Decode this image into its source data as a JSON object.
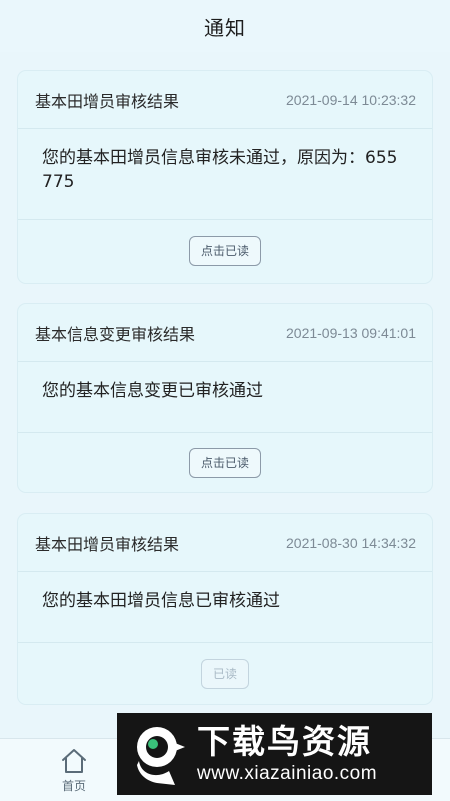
{
  "header": {
    "title": "通知"
  },
  "notifications": [
    {
      "title": "基本田增员审核结果",
      "time": "2021-09-14 10:23:32",
      "content": "您的基本田增员信息审核未通过，原因为：655775",
      "button": "点击已读",
      "read": false
    },
    {
      "title": "基本信息变更审核结果",
      "time": "2021-09-13 09:41:01",
      "content": "您的基本信息变更已审核通过",
      "button": "点击已读",
      "read": false
    },
    {
      "title": "基本田增员审核结果",
      "time": "2021-08-30 14:34:32",
      "content": "您的基本田增员信息已审核通过",
      "button": "已读",
      "read": true
    }
  ],
  "tabbar": {
    "items": [
      {
        "label": "首页",
        "icon": "home-icon"
      }
    ]
  },
  "watermark": {
    "brand": "下载鸟资源",
    "url": "www.xiazainiao.com"
  },
  "colors": {
    "background": "#e9f6fb",
    "card": "#e6f7fb",
    "time_text": "#7d8a95",
    "watermark_bg": "#151515",
    "watermark_accent": "#3ac07a"
  }
}
